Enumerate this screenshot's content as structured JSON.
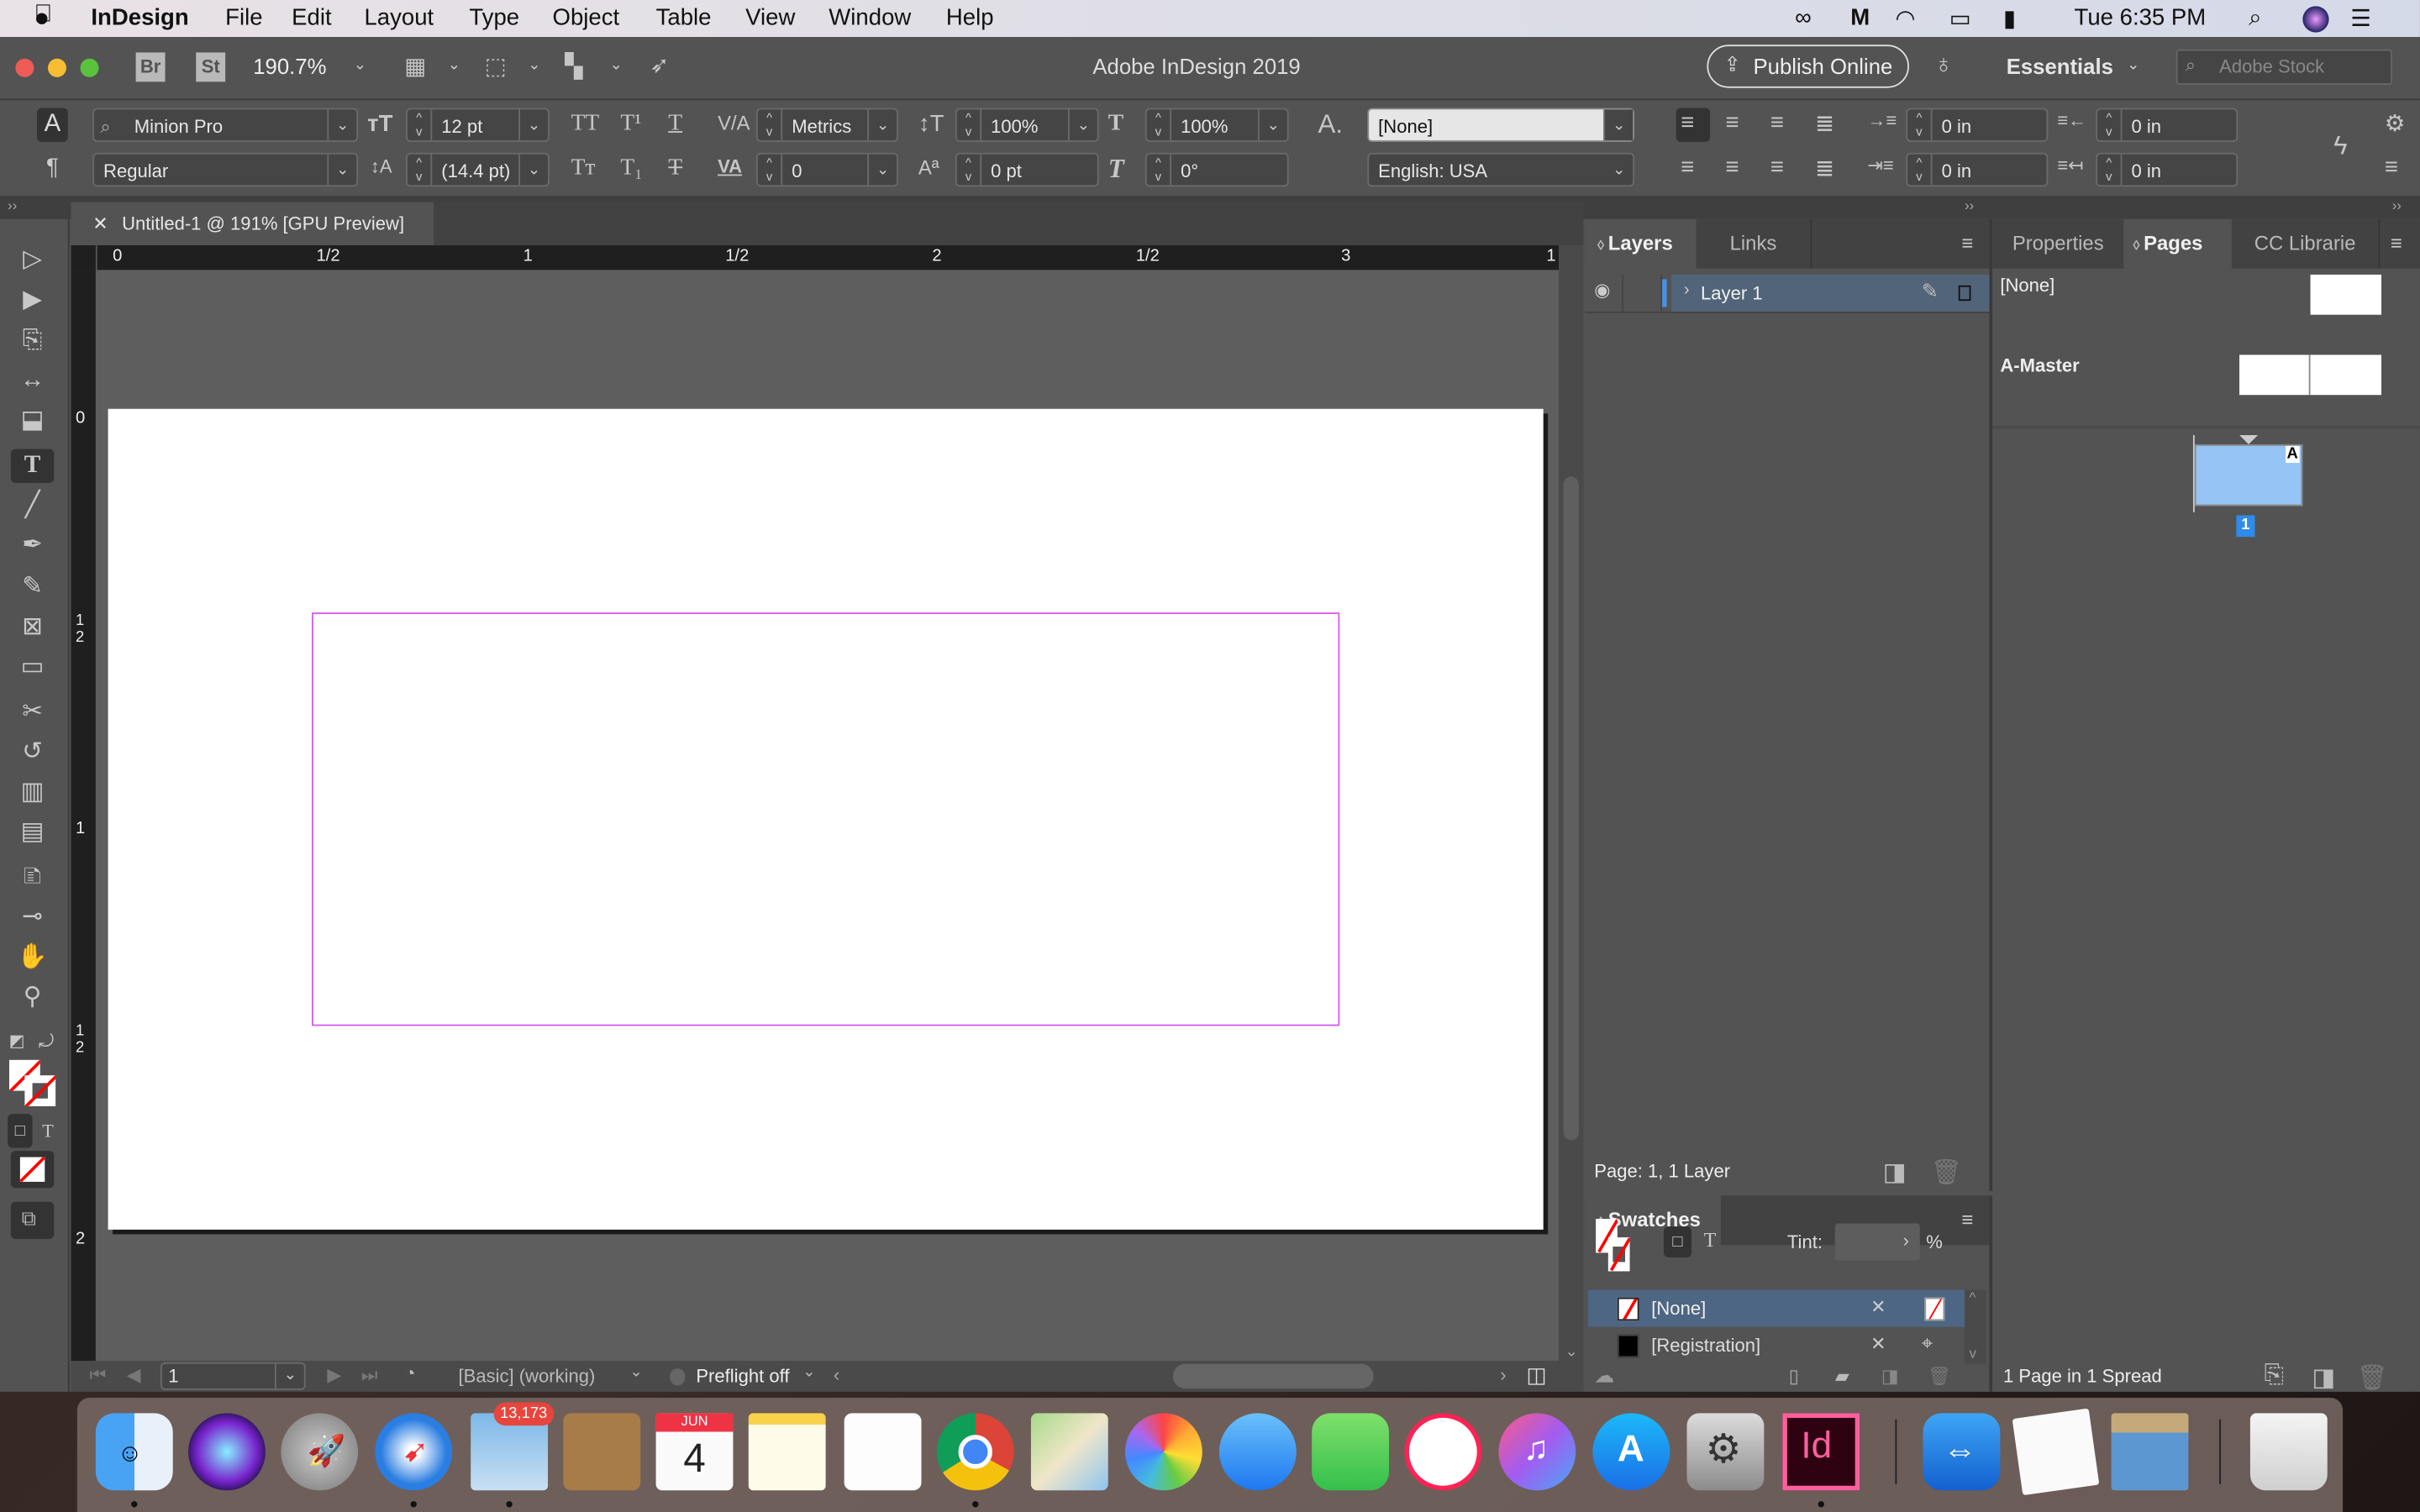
{
  "menubar": {
    "app_name": "InDesign",
    "items": [
      "File",
      "Edit",
      "Layout",
      "Type",
      "Object",
      "Table",
      "View",
      "Window",
      "Help"
    ],
    "clock": "Tue 6:35 PM",
    "status_icons": [
      "creative-cloud-icon",
      "malwarebytes-icon",
      "wifi-icon",
      "airplay-icon",
      "battery-icon",
      "spotlight-icon",
      "siri-icon",
      "notification-center-icon"
    ]
  },
  "titlebar": {
    "bridge_label": "Br",
    "stock_label": "St",
    "zoom_value": "190.7%",
    "window_title": "Adobe InDesign 2019",
    "publish_label": "Publish Online",
    "workspace_label": "Essentials",
    "stock_search_placeholder": "Adobe Stock"
  },
  "control": {
    "font_family": "Minion Pro",
    "font_style": "Regular",
    "font_size": "12 pt",
    "leading": "(14.4 pt)",
    "kerning": "Metrics",
    "tracking": "0",
    "vertical_scale": "100%",
    "horizontal_scale": "100%",
    "baseline_shift": "0 pt",
    "skew": "0°",
    "char_style": "[None]",
    "language": "English: USA",
    "left_indent": "0 in",
    "right_indent": "0 in",
    "first_line_indent": "0 in",
    "last_line_indent": "0 in",
    "char_mode_label": "A",
    "para_mode_label": "¶"
  },
  "document": {
    "tab_title": "Untitled-1 @ 191% [GPU Preview]",
    "hruler_labels": [
      "0",
      "1/2",
      "1",
      "1/2",
      "2",
      "1/2",
      "3",
      "1"
    ],
    "vruler_labels": [
      "0",
      "1/2",
      "1",
      "1/2",
      "2"
    ],
    "margin_color": "#d65ef0"
  },
  "statusbar": {
    "page_number": "1",
    "preflight_profile": "[Basic] (working)",
    "preflight_status": "Preflight off"
  },
  "layers_panel": {
    "tabs": [
      "Layers",
      "Links"
    ],
    "layers": [
      {
        "name": "Layer 1",
        "visible": true,
        "color": "#4a90e2"
      }
    ],
    "footer": "Page: 1, 1 Layer"
  },
  "pages_panel": {
    "tabs": [
      "Properties",
      "Pages",
      "CC Librarie"
    ],
    "masters": [
      "[None]",
      "A-Master"
    ],
    "page_label": "1",
    "master_letter": "A",
    "footer": "1 Page in 1 Spread"
  },
  "swatches_panel": {
    "tab": "Swatches",
    "tint_label": "Tint:",
    "tint_value": "",
    "percent": "%",
    "swatches": [
      {
        "name": "[None]",
        "selected": true
      },
      {
        "name": "[Registration]",
        "selected": false
      }
    ]
  },
  "dock": {
    "apps": [
      "Finder",
      "Siri",
      "Launchpad",
      "Safari",
      "Mail",
      "Contacts",
      "Calendar",
      "Notes",
      "Reminders",
      "Chrome",
      "Maps",
      "Photos",
      "Messages",
      "FaceTime",
      "News",
      "iTunes",
      "App Store",
      "System Preferences",
      "InDesign",
      "TeamViewer",
      "TextEdit",
      "Preview",
      "Trash"
    ],
    "mail_badge": "13,173",
    "calendar_month": "JUN",
    "calendar_day": "4",
    "indesign_label": "Id"
  }
}
